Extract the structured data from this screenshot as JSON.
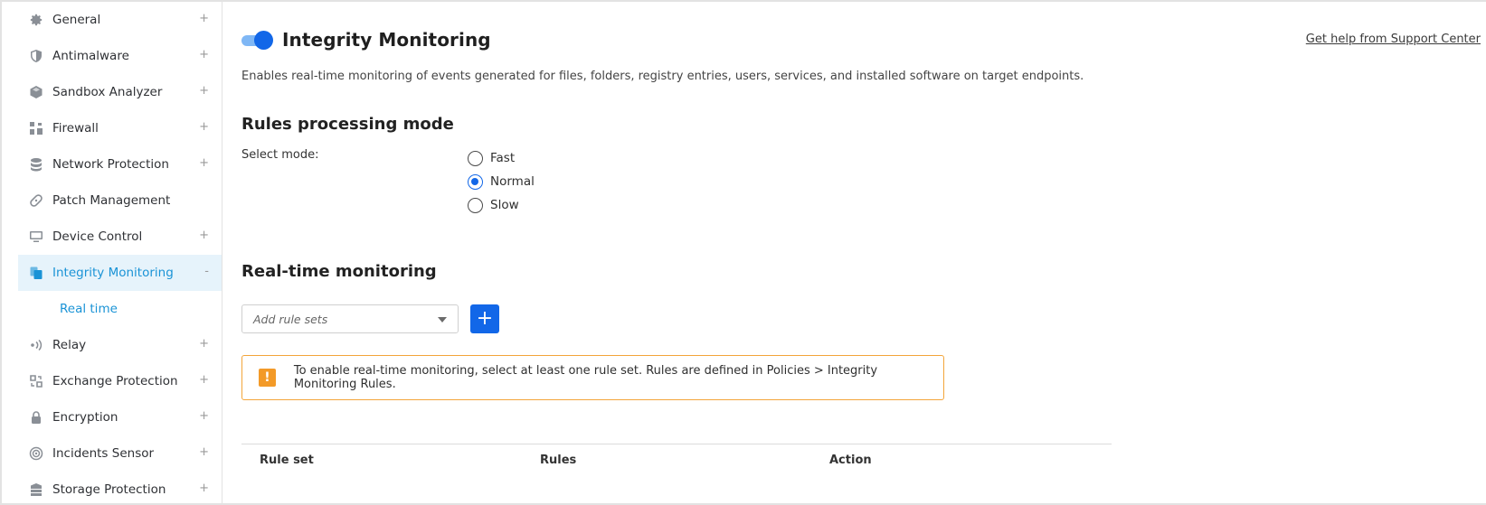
{
  "sidebar": {
    "items": [
      {
        "label": "General",
        "toggle": "+",
        "icon": "gear-icon"
      },
      {
        "label": "Antimalware",
        "toggle": "+",
        "icon": "shield-icon"
      },
      {
        "label": "Sandbox Analyzer",
        "toggle": "+",
        "icon": "cube-icon"
      },
      {
        "label": "Firewall",
        "toggle": "+",
        "icon": "firewall-icon"
      },
      {
        "label": "Network Protection",
        "toggle": "+",
        "icon": "database-icon"
      },
      {
        "label": "Patch Management",
        "toggle": "",
        "icon": "patch-icon"
      },
      {
        "label": "Device Control",
        "toggle": "+",
        "icon": "monitor-icon"
      },
      {
        "label": "Integrity Monitoring",
        "toggle": "-",
        "icon": "files-icon",
        "active": true
      },
      {
        "label": "Relay",
        "toggle": "+",
        "icon": "relay-icon"
      },
      {
        "label": "Exchange Protection",
        "toggle": "+",
        "icon": "exchange-icon"
      },
      {
        "label": "Encryption",
        "toggle": "+",
        "icon": "lock-icon"
      },
      {
        "label": "Incidents Sensor",
        "toggle": "+",
        "icon": "sensor-icon"
      },
      {
        "label": "Storage Protection",
        "toggle": "+",
        "icon": "storage-icon"
      }
    ],
    "sub_item": {
      "label": "Real time"
    }
  },
  "header": {
    "title": "Integrity Monitoring",
    "enabled": true,
    "help_link": "Get help from Support Center",
    "description": "Enables real-time monitoring of events generated for files, folders, registry entries, users, services, and installed software on target endpoints."
  },
  "rules_mode": {
    "title": "Rules processing mode",
    "select_label": "Select mode:",
    "options": [
      "Fast",
      "Normal",
      "Slow"
    ],
    "selected": "Normal"
  },
  "realtime": {
    "title": "Real-time monitoring",
    "select_placeholder": "Add rule sets",
    "add_label": "+",
    "warning": "To enable real-time monitoring, select at least one rule set. Rules are defined in Policies > Integrity Monitoring Rules.",
    "warning_icon": "!"
  },
  "table": {
    "columns": [
      "Rule set",
      "Rules",
      "Action"
    ]
  },
  "colors": {
    "accent": "#1267e8",
    "active_nav_bg": "#e6f3fb",
    "active_nav_text": "#1a93d6",
    "warning": "#f39a28"
  }
}
